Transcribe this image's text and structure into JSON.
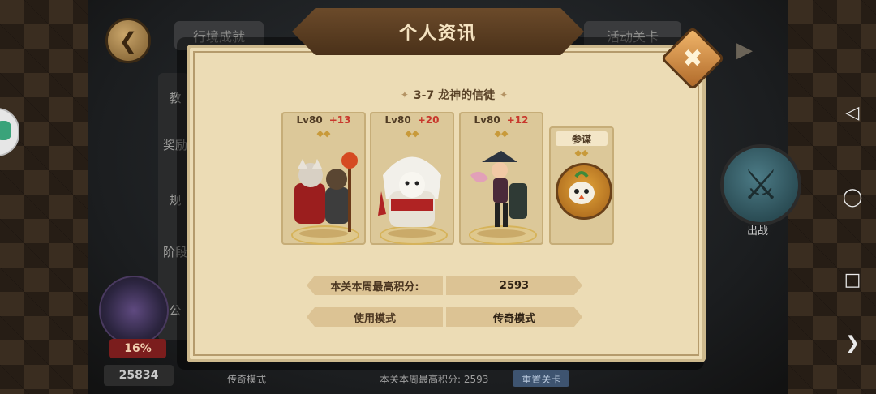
{
  "background": {
    "tab_left": "行境成就",
    "tab_right": "活动关卡",
    "sidebar_items": [
      "教",
      "奖励",
      "规",
      "阶段",
      "公"
    ],
    "progress_pct": "16%",
    "score": "25834",
    "mode_text": "传奇模式",
    "weekly_best": "本关本周最高积分: 2593",
    "reset_label": "重置关卡",
    "battle_label": "出战"
  },
  "modal": {
    "title": "个人资讯",
    "stage": "3-7 龙神的信徒",
    "heroes": [
      {
        "level": "Lv80",
        "bonus": "+13",
        "stars": "◆◆"
      },
      {
        "level": "Lv80",
        "bonus": "+20",
        "stars": "◆◆"
      },
      {
        "level": "Lv80",
        "bonus": "+12",
        "stars": "◆◆"
      }
    ],
    "advisor": {
      "label": "参谋",
      "stars": "◆◆"
    },
    "rows": [
      {
        "label": "本关本周最高积分:",
        "value": "2593"
      },
      {
        "label": "使用模式",
        "value": "传奇模式"
      }
    ]
  },
  "colors": {
    "parchment": "#ecdcb5",
    "header": "#4a3119",
    "accent_red": "#c8372c",
    "close_orange": "#e29a48"
  },
  "icons": {
    "back": "arrow-left-icon",
    "close": "close-icon",
    "nav_back": "triangle-back-icon",
    "nav_home": "circle-home-icon",
    "nav_recent": "square-recent-icon",
    "nav_expand": "chevron-right-icon"
  }
}
